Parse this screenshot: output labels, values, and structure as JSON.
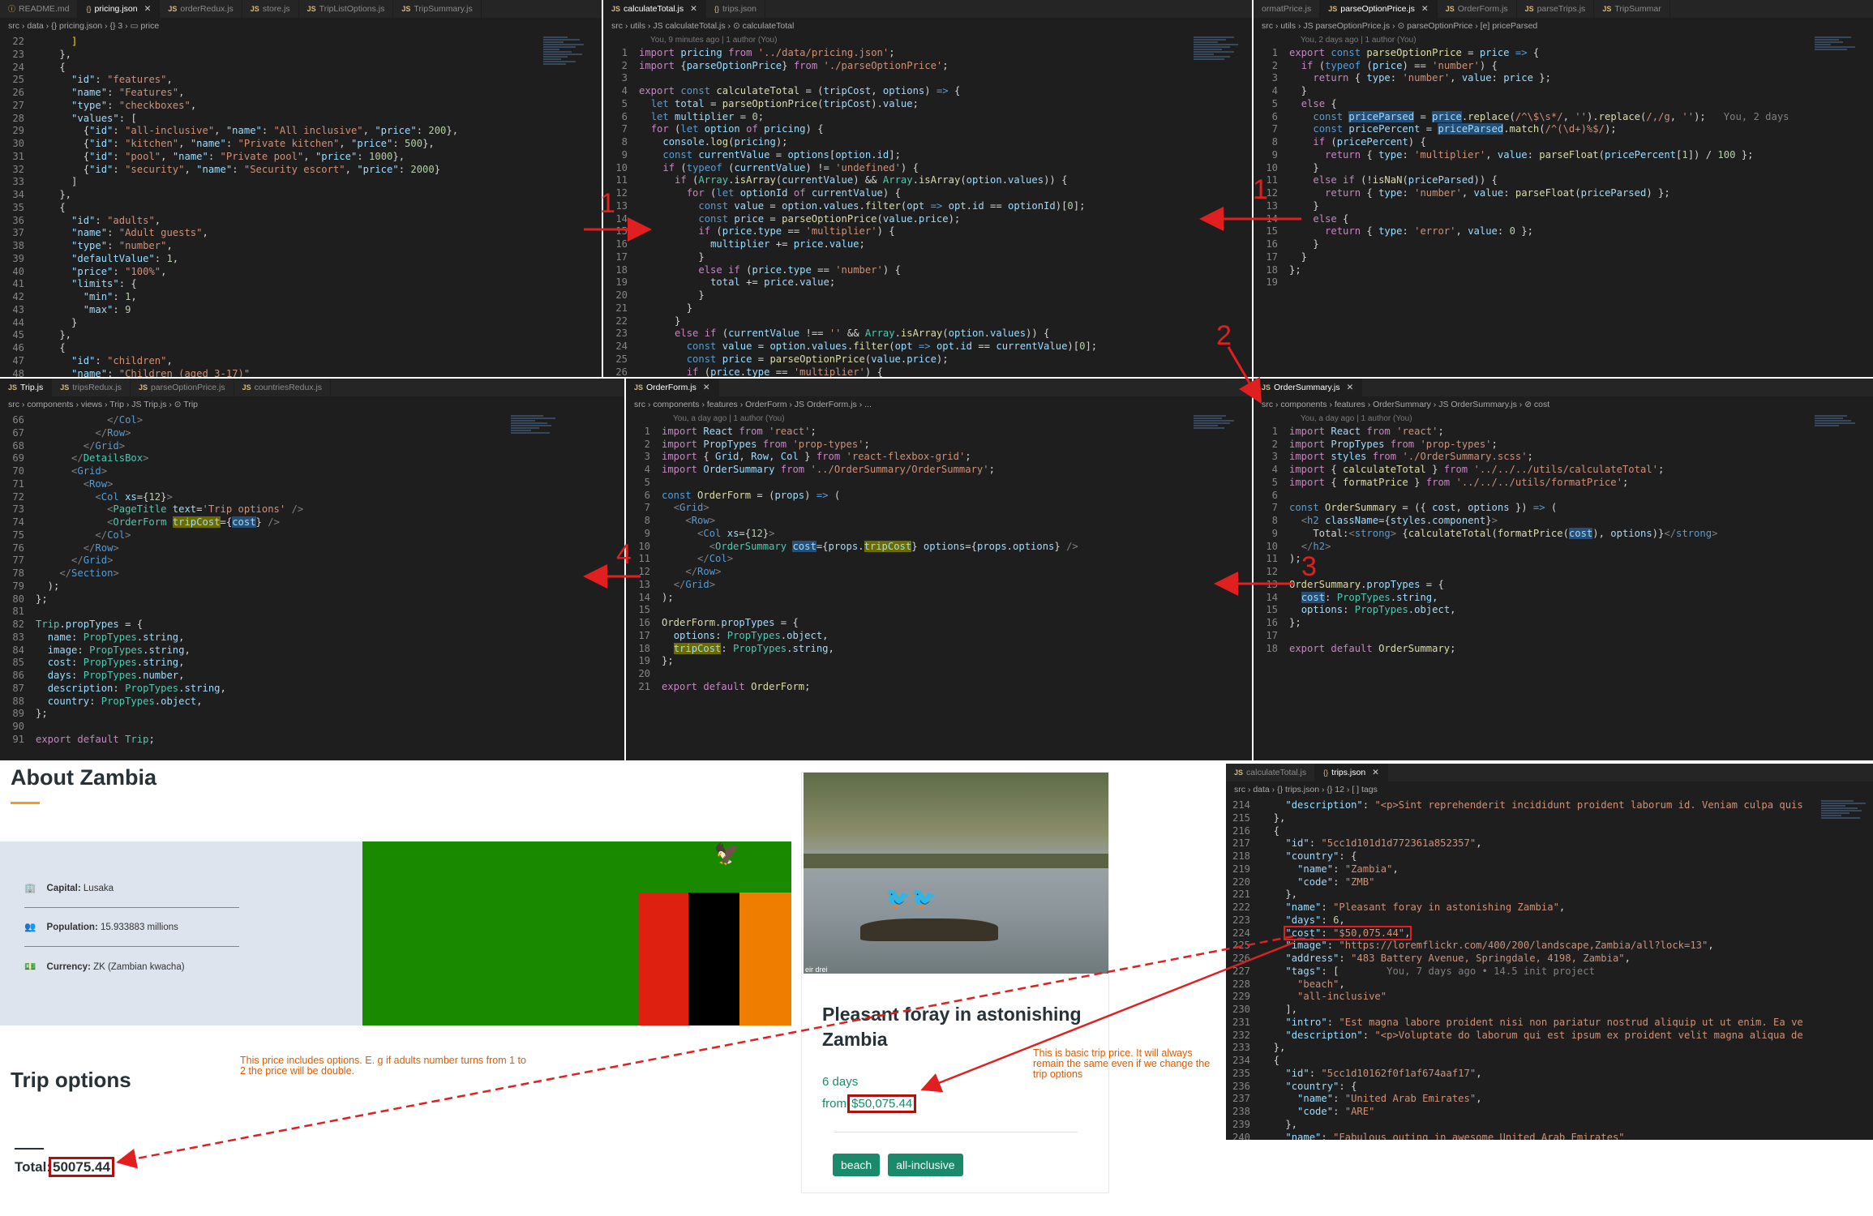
{
  "panes": {
    "pricing": {
      "tabs": [
        {
          "label": "README.md",
          "icon": "md"
        },
        {
          "label": "pricing.json",
          "active": true,
          "icon": "{}"
        },
        {
          "label": "orderRedux.js",
          "icon": "JS"
        },
        {
          "label": "store.js",
          "icon": "JS"
        },
        {
          "label": "TripListOptions.js",
          "icon": "JS"
        },
        {
          "label": "TripSummary.js",
          "icon": "JS"
        }
      ],
      "crumb": "src › data › {} pricing.json › {} 3 › ▭ price"
    },
    "calc": {
      "tabs": [
        {
          "label": "calculateTotal.js",
          "active": true,
          "icon": "JS"
        },
        {
          "label": "trips.json",
          "icon": "{}"
        }
      ],
      "crumb": "src › utils › JS calculateTotal.js › ⊙ calculateTotal",
      "blame": "You, 9 minutes ago | 1 author (You)"
    },
    "parse": {
      "tabs": [
        {
          "label": "ormatPrice.js",
          "icon": ""
        },
        {
          "label": "parseOptionPrice.js",
          "active": true,
          "icon": "JS"
        },
        {
          "label": "OrderForm.js",
          "icon": "JS"
        },
        {
          "label": "parseTrips.js",
          "icon": "JS"
        },
        {
          "label": "TripSummar",
          "icon": "JS"
        }
      ],
      "crumb": "src › utils › JS parseOptionPrice.js › ⊙ parseOptionPrice › [e] priceParsed",
      "blame": "You, 2 days ago | 1 author (You)"
    },
    "trip": {
      "tabs": [
        {
          "label": "Trip.js",
          "active": true,
          "icon": "JS"
        },
        {
          "label": "tripsRedux.js",
          "icon": "JS"
        },
        {
          "label": "parseOptionPrice.js",
          "icon": "JS"
        },
        {
          "label": "countriesRedux.js",
          "icon": "JS"
        }
      ],
      "crumb": "src › components › views › Trip › JS Trip.js › ⊙ Trip"
    },
    "orderform": {
      "tabs": [
        {
          "label": "OrderForm.js",
          "active": true,
          "icon": "JS"
        }
      ],
      "crumb": "src › components › features › OrderForm › JS OrderForm.js › ...",
      "blame": "You, a day ago | 1 author (You)"
    },
    "ordersummary": {
      "tabs": [
        {
          "label": "OrderSummary.js",
          "active": true,
          "icon": "JS"
        }
      ],
      "crumb": "src › components › features › OrderSummary › JS OrderSummary.js › ⊘ cost",
      "blame": "You, a day ago | 1 author (You)"
    },
    "trips": {
      "tabs": [
        {
          "label": "calculateTotal.js",
          "icon": "JS"
        },
        {
          "label": "trips.json",
          "active": true,
          "icon": "{}"
        }
      ],
      "crumb": "src › data › {} trips.json › {} 12 › [ ] tags"
    }
  },
  "web": {
    "about_title": "About Zambia",
    "capital_label": "Capital:",
    "capital": "Lusaka",
    "population_label": "Population:",
    "population": "15.933883 millions",
    "currency_label": "Currency:",
    "currency": "ZK (Zambian kwacha)",
    "trip_options": "Trip options",
    "total_label": "Total:",
    "total_value": "50075.44",
    "card_title": "Pleasant foray in astonishing Zambia",
    "card_days": "6 days",
    "card_from": "from",
    "card_price": "$50,075.44",
    "tags": [
      "beach",
      "all-inclusive"
    ],
    "photo_credit": "eir drei"
  },
  "annotations": {
    "n1a": "1",
    "n1b": "1",
    "n2": "2",
    "n3": "3",
    "n4": "4",
    "note_left": "This price includes options. E. g if adults number turns from 1 to 2 the price will be double.",
    "note_right": "This is basic trip price. It will always remain the same  even if we change the trip options"
  },
  "colors": {
    "accent_red": "#e02020",
    "tag_green": "#1a8a6a",
    "price_green": "#1a8a6a",
    "note_orange": "#e05a00"
  }
}
